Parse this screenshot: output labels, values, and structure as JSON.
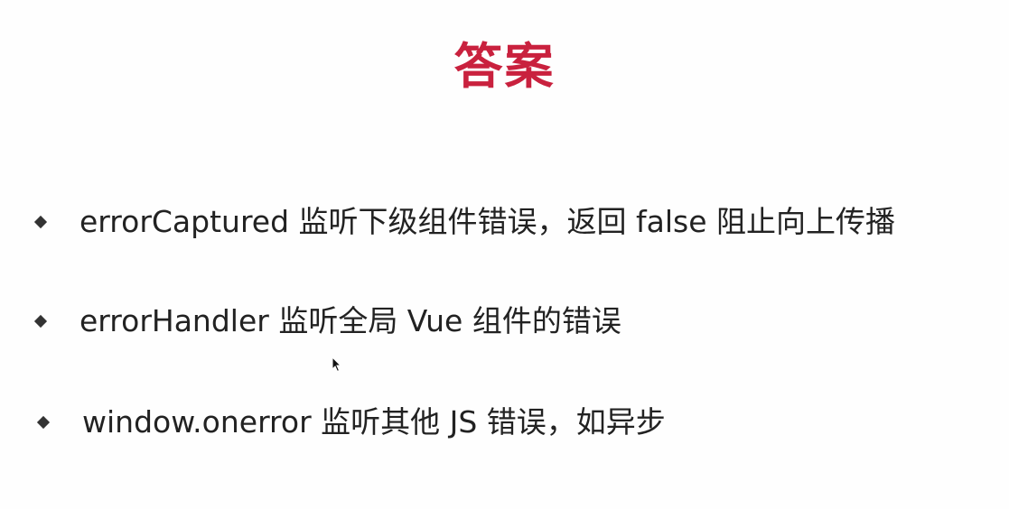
{
  "slide": {
    "title": "答案",
    "title_color": "#c9213e",
    "bullets": [
      {
        "text": "errorCaptured 监听下级组件错误，返回 false 阻止向上传播"
      },
      {
        "text": "errorHandler 监听全局 Vue 组件的错误"
      },
      {
        "text": "window.onerror 监听其他 JS 错误，如异步"
      }
    ],
    "bullet_icon": "diamond-bullet-icon",
    "cursor_icon": "mouse-pointer-icon"
  }
}
